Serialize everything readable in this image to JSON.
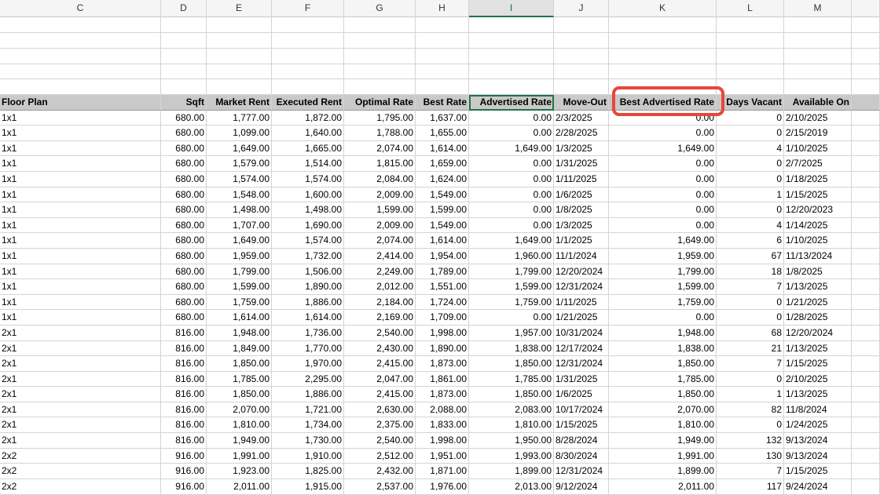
{
  "spreadsheet": {
    "column_letters": [
      "C",
      "D",
      "E",
      "F",
      "G",
      "H",
      "I",
      "J",
      "K",
      "L",
      "M",
      ""
    ],
    "selected_column": "I",
    "accent_color": "#217346",
    "highlight_color": "#e8453c",
    "highlighted_header": "Best Advertised Rate",
    "headers": [
      "Floor Plan",
      "Sqft",
      "Market Rent",
      "Executed Rent",
      "Optimal Rate",
      "Best Rate",
      "Advertised Rate",
      "Move-Out",
      "Best Advertised Rate",
      "Days Vacant",
      "Available On",
      ""
    ],
    "rows": [
      [
        "1x1",
        "680.00",
        "1,777.00",
        "1,872.00",
        "1,795.00",
        "1,637.00",
        "0.00",
        "2/3/2025",
        "0.00",
        "0",
        "2/10/2025"
      ],
      [
        "1x1",
        "680.00",
        "1,099.00",
        "1,640.00",
        "1,788.00",
        "1,655.00",
        "0.00",
        "2/28/2025",
        "0.00",
        "0",
        "2/15/2019"
      ],
      [
        "1x1",
        "680.00",
        "1,649.00",
        "1,665.00",
        "2,074.00",
        "1,614.00",
        "1,649.00",
        "1/3/2025",
        "1,649.00",
        "4",
        "1/10/2025"
      ],
      [
        "1x1",
        "680.00",
        "1,579.00",
        "1,514.00",
        "1,815.00",
        "1,659.00",
        "0.00",
        "1/31/2025",
        "0.00",
        "0",
        "2/7/2025"
      ],
      [
        "1x1",
        "680.00",
        "1,574.00",
        "1,574.00",
        "2,084.00",
        "1,624.00",
        "0.00",
        "1/11/2025",
        "0.00",
        "0",
        "1/18/2025"
      ],
      [
        "1x1",
        "680.00",
        "1,548.00",
        "1,600.00",
        "2,009.00",
        "1,549.00",
        "0.00",
        "1/6/2025",
        "0.00",
        "1",
        "1/15/2025"
      ],
      [
        "1x1",
        "680.00",
        "1,498.00",
        "1,498.00",
        "1,599.00",
        "1,599.00",
        "0.00",
        "1/8/2025",
        "0.00",
        "0",
        "12/20/2023"
      ],
      [
        "1x1",
        "680.00",
        "1,707.00",
        "1,690.00",
        "2,009.00",
        "1,549.00",
        "0.00",
        "1/3/2025",
        "0.00",
        "4",
        "1/14/2025"
      ],
      [
        "1x1",
        "680.00",
        "1,649.00",
        "1,574.00",
        "2,074.00",
        "1,614.00",
        "1,649.00",
        "1/1/2025",
        "1,649.00",
        "6",
        "1/10/2025"
      ],
      [
        "1x1",
        "680.00",
        "1,959.00",
        "1,732.00",
        "2,414.00",
        "1,954.00",
        "1,960.00",
        "11/1/2024",
        "1,959.00",
        "67",
        "11/13/2024"
      ],
      [
        "1x1",
        "680.00",
        "1,799.00",
        "1,506.00",
        "2,249.00",
        "1,789.00",
        "1,799.00",
        "12/20/2024",
        "1,799.00",
        "18",
        "1/8/2025"
      ],
      [
        "1x1",
        "680.00",
        "1,599.00",
        "1,890.00",
        "2,012.00",
        "1,551.00",
        "1,599.00",
        "12/31/2024",
        "1,599.00",
        "7",
        "1/13/2025"
      ],
      [
        "1x1",
        "680.00",
        "1,759.00",
        "1,886.00",
        "2,184.00",
        "1,724.00",
        "1,759.00",
        "1/11/2025",
        "1,759.00",
        "0",
        "1/21/2025"
      ],
      [
        "1x1",
        "680.00",
        "1,614.00",
        "1,614.00",
        "2,169.00",
        "1,709.00",
        "0.00",
        "1/21/2025",
        "0.00",
        "0",
        "1/28/2025"
      ],
      [
        "2x1",
        "816.00",
        "1,948.00",
        "1,736.00",
        "2,540.00",
        "1,998.00",
        "1,957.00",
        "10/31/2024",
        "1,948.00",
        "68",
        "12/20/2024"
      ],
      [
        "2x1",
        "816.00",
        "1,849.00",
        "1,770.00",
        "2,430.00",
        "1,890.00",
        "1,838.00",
        "12/17/2024",
        "1,838.00",
        "21",
        "1/13/2025"
      ],
      [
        "2x1",
        "816.00",
        "1,850.00",
        "1,970.00",
        "2,415.00",
        "1,873.00",
        "1,850.00",
        "12/31/2024",
        "1,850.00",
        "7",
        "1/15/2025"
      ],
      [
        "2x1",
        "816.00",
        "1,785.00",
        "2,295.00",
        "2,047.00",
        "1,861.00",
        "1,785.00",
        "1/31/2025",
        "1,785.00",
        "0",
        "2/10/2025"
      ],
      [
        "2x1",
        "816.00",
        "1,850.00",
        "1,886.00",
        "2,415.00",
        "1,873.00",
        "1,850.00",
        "1/6/2025",
        "1,850.00",
        "1",
        "1/13/2025"
      ],
      [
        "2x1",
        "816.00",
        "2,070.00",
        "1,721.00",
        "2,630.00",
        "2,088.00",
        "2,083.00",
        "10/17/2024",
        "2,070.00",
        "82",
        "11/8/2024"
      ],
      [
        "2x1",
        "816.00",
        "1,810.00",
        "1,734.00",
        "2,375.00",
        "1,833.00",
        "1,810.00",
        "1/15/2025",
        "1,810.00",
        "0",
        "1/24/2025"
      ],
      [
        "2x1",
        "816.00",
        "1,949.00",
        "1,730.00",
        "2,540.00",
        "1,998.00",
        "1,950.00",
        "8/28/2024",
        "1,949.00",
        "132",
        "9/13/2024"
      ],
      [
        "2x2",
        "916.00",
        "1,991.00",
        "1,910.00",
        "2,512.00",
        "1,951.00",
        "1,993.00",
        "8/30/2024",
        "1,991.00",
        "130",
        "9/13/2024"
      ],
      [
        "2x2",
        "916.00",
        "1,923.00",
        "1,825.00",
        "2,432.00",
        "1,871.00",
        "1,899.00",
        "12/31/2024",
        "1,899.00",
        "7",
        "1/15/2025"
      ],
      [
        "2x2",
        "916.00",
        "2,011.00",
        "1,915.00",
        "2,537.00",
        "1,976.00",
        "2,013.00",
        "9/12/2024",
        "2,011.00",
        "117",
        "9/24/2024"
      ]
    ]
  }
}
